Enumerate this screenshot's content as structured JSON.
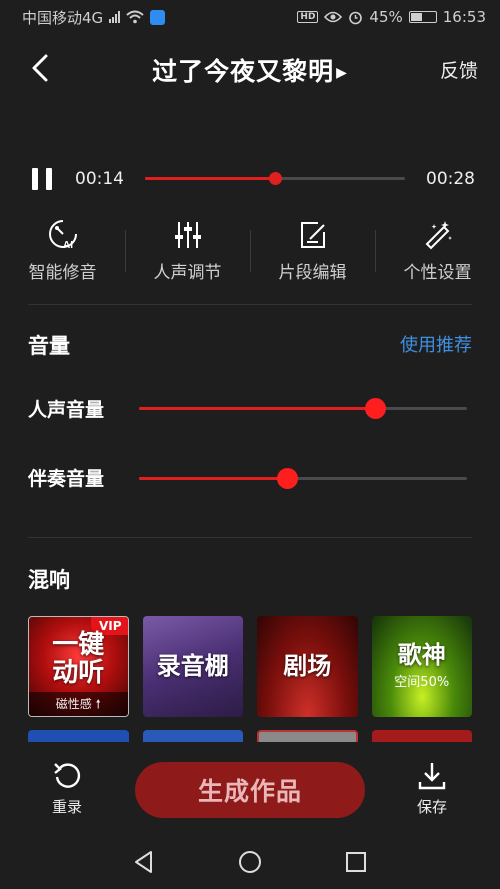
{
  "status_bar": {
    "carrier": "中国移动4G",
    "network_badge": "4G",
    "battery": "45%",
    "time": "16:53",
    "hd_label": "HD"
  },
  "header": {
    "title": "过了今夜又黎明",
    "feedback_label": "反馈"
  },
  "player": {
    "current_time": "00:14",
    "total_time": "00:28",
    "progress": 0.5
  },
  "tools": [
    {
      "label": "智能修音",
      "icon": "ai-tune-icon"
    },
    {
      "label": "人声调节",
      "icon": "sliders-icon"
    },
    {
      "label": "片段编辑",
      "icon": "edit-icon"
    },
    {
      "label": "个性设置",
      "icon": "magic-wand-icon"
    }
  ],
  "volume": {
    "title": "音量",
    "recommend_label": "使用推荐",
    "vocal_label": "人声音量",
    "vocal_level": 0.72,
    "accompaniment_label": "伴奏音量",
    "accompaniment_level": 0.45
  },
  "reverb": {
    "title": "混响",
    "tiles": [
      {
        "name_line1": "一键",
        "name_line2": "动听",
        "badge": "VIP",
        "footer": "磁性感 🠕"
      },
      {
        "name": "录音棚"
      },
      {
        "name": "剧场"
      },
      {
        "name": "歌神",
        "sub": "空间50%"
      }
    ]
  },
  "bottom": {
    "redo_label": "重录",
    "generate_label": "生成作品",
    "save_label": "保存"
  },
  "colors": {
    "accent": "#e0201f",
    "link": "#3d8fe0",
    "background": "#1e1e1e"
  }
}
